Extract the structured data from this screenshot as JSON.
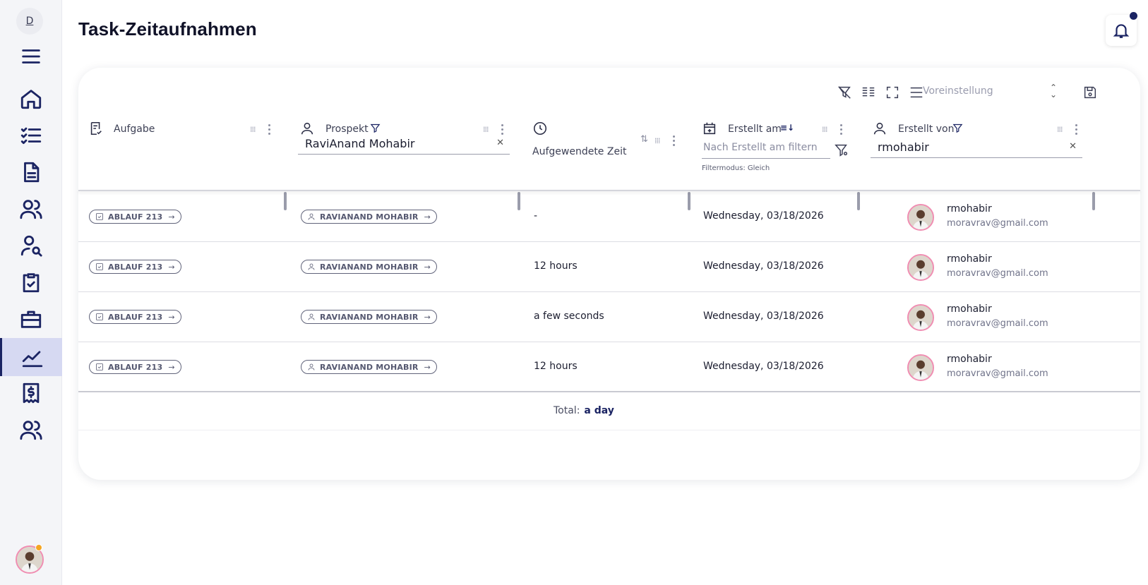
{
  "sidebar": {
    "workspace_initial": "D",
    "items": [
      {
        "name": "menu"
      },
      {
        "name": "home"
      },
      {
        "name": "tasks"
      },
      {
        "name": "documents"
      },
      {
        "name": "contacts"
      },
      {
        "name": "prospects-search"
      },
      {
        "name": "clipboard"
      },
      {
        "name": "briefcase"
      },
      {
        "name": "analytics"
      },
      {
        "name": "invoices"
      },
      {
        "name": "team"
      }
    ]
  },
  "header": {
    "title": "Task-Zeitaufnahmen"
  },
  "toolbar": {
    "preset_placeholder": "Voreinstellung"
  },
  "columns": {
    "task": {
      "label": "Aufgabe"
    },
    "prospect": {
      "label": "Prospekt",
      "filter_value": "RaviAnand Mohabir"
    },
    "time": {
      "label": "Aufgewendete Zeit"
    },
    "created_at": {
      "label": "Erstellt am",
      "filter_placeholder": "Nach Erstellt am filtern",
      "filter_mode": "Filtermodus: Gleich"
    },
    "created_by": {
      "label": "Erstellt von",
      "filter_value": "rmohabir"
    }
  },
  "rows": [
    {
      "task": "ABLAUF 213",
      "prospect": "RAVIANAND MOHABIR",
      "time": "-",
      "created_at": "Wednesday, 03/18/2026",
      "user": "rmohabir",
      "email": "moravrav@gmail.com"
    },
    {
      "task": "ABLAUF 213",
      "prospect": "RAVIANAND MOHABIR",
      "time": "12 hours",
      "created_at": "Wednesday, 03/18/2026",
      "user": "rmohabir",
      "email": "moravrav@gmail.com"
    },
    {
      "task": "ABLAUF 213",
      "prospect": "RAVIANAND MOHABIR",
      "time": "a few seconds",
      "created_at": "Wednesday, 03/18/2026",
      "user": "rmohabir",
      "email": "moravrav@gmail.com"
    },
    {
      "task": "ABLAUF 213",
      "prospect": "RAVIANAND MOHABIR",
      "time": "12 hours",
      "created_at": "Wednesday, 03/18/2026",
      "user": "rmohabir",
      "email": "moravrav@gmail.com"
    }
  ],
  "footer": {
    "total_label": "Total:",
    "total_value": "a day"
  },
  "colors": {
    "accent": "#1b2463",
    "active_nav_bg": "#d6d9f2",
    "avatar_ring": "#f08db2",
    "status_dot": "#f5a623"
  }
}
